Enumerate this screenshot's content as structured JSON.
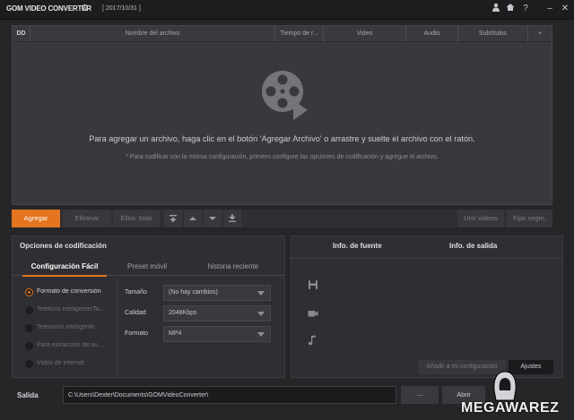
{
  "titlebar": {
    "app_title": "GOM VIDEO CONVERTER",
    "date": "[ 2017/10/31 ]",
    "icons": [
      "user-icon",
      "home-icon",
      "help-icon",
      "minimize-icon",
      "close-icon"
    ]
  },
  "file_list": {
    "columns": {
      "dd": "DD",
      "name": "Nombre del archivo",
      "time": "Tiempo de r...",
      "video": "Video",
      "audio": "Audio",
      "subs": "Subtítulos",
      "add": "+"
    },
    "hint_main": "Para agregar un archivo, haga clic en el botón 'Agregar Archivo' o arrastre y suelte el archivo con el ratón.",
    "hint_sub": "* Para codificar con la misma configuración, primero configure las opciones de codificación y agregue el archivo."
  },
  "toolbar": {
    "add": "Agregar",
    "delete": "Eliminar",
    "delete_all": "Elimi. todo",
    "join": "Unir videos",
    "set_segments": "Fijar segm."
  },
  "options": {
    "title": "Opciones de codificación",
    "tabs": [
      "Configuración Fácil",
      "Preset móvil",
      "historia reciente"
    ],
    "radios": [
      "Formato de conversión",
      "Teléfono inteligente/Ta...",
      "Televisión inteligente",
      "Para extracción de au...",
      "Video de internet"
    ],
    "fields": {
      "size_label": "Tamaño",
      "size_value": "(No hay cambios)",
      "quality_label": "Calidad",
      "quality_value": "2048Kbps",
      "format_label": "Formato",
      "format_value": "MP4"
    }
  },
  "info": {
    "source_tab": "Info. de fuente",
    "output_tab": "Info. de salida",
    "add_to_config": "Añadir a mi configuración",
    "settings": "Ajustes"
  },
  "output": {
    "label": "Salida",
    "path": "C:\\Users\\Dexter\\Documents\\GOMVideoConverter\\",
    "browse": "...",
    "open": "Abrir"
  },
  "watermark": {
    "text": "MEGAWAREZ"
  },
  "colors": {
    "accent": "#e4741f",
    "background": "#262629",
    "panel": "#39393d"
  }
}
